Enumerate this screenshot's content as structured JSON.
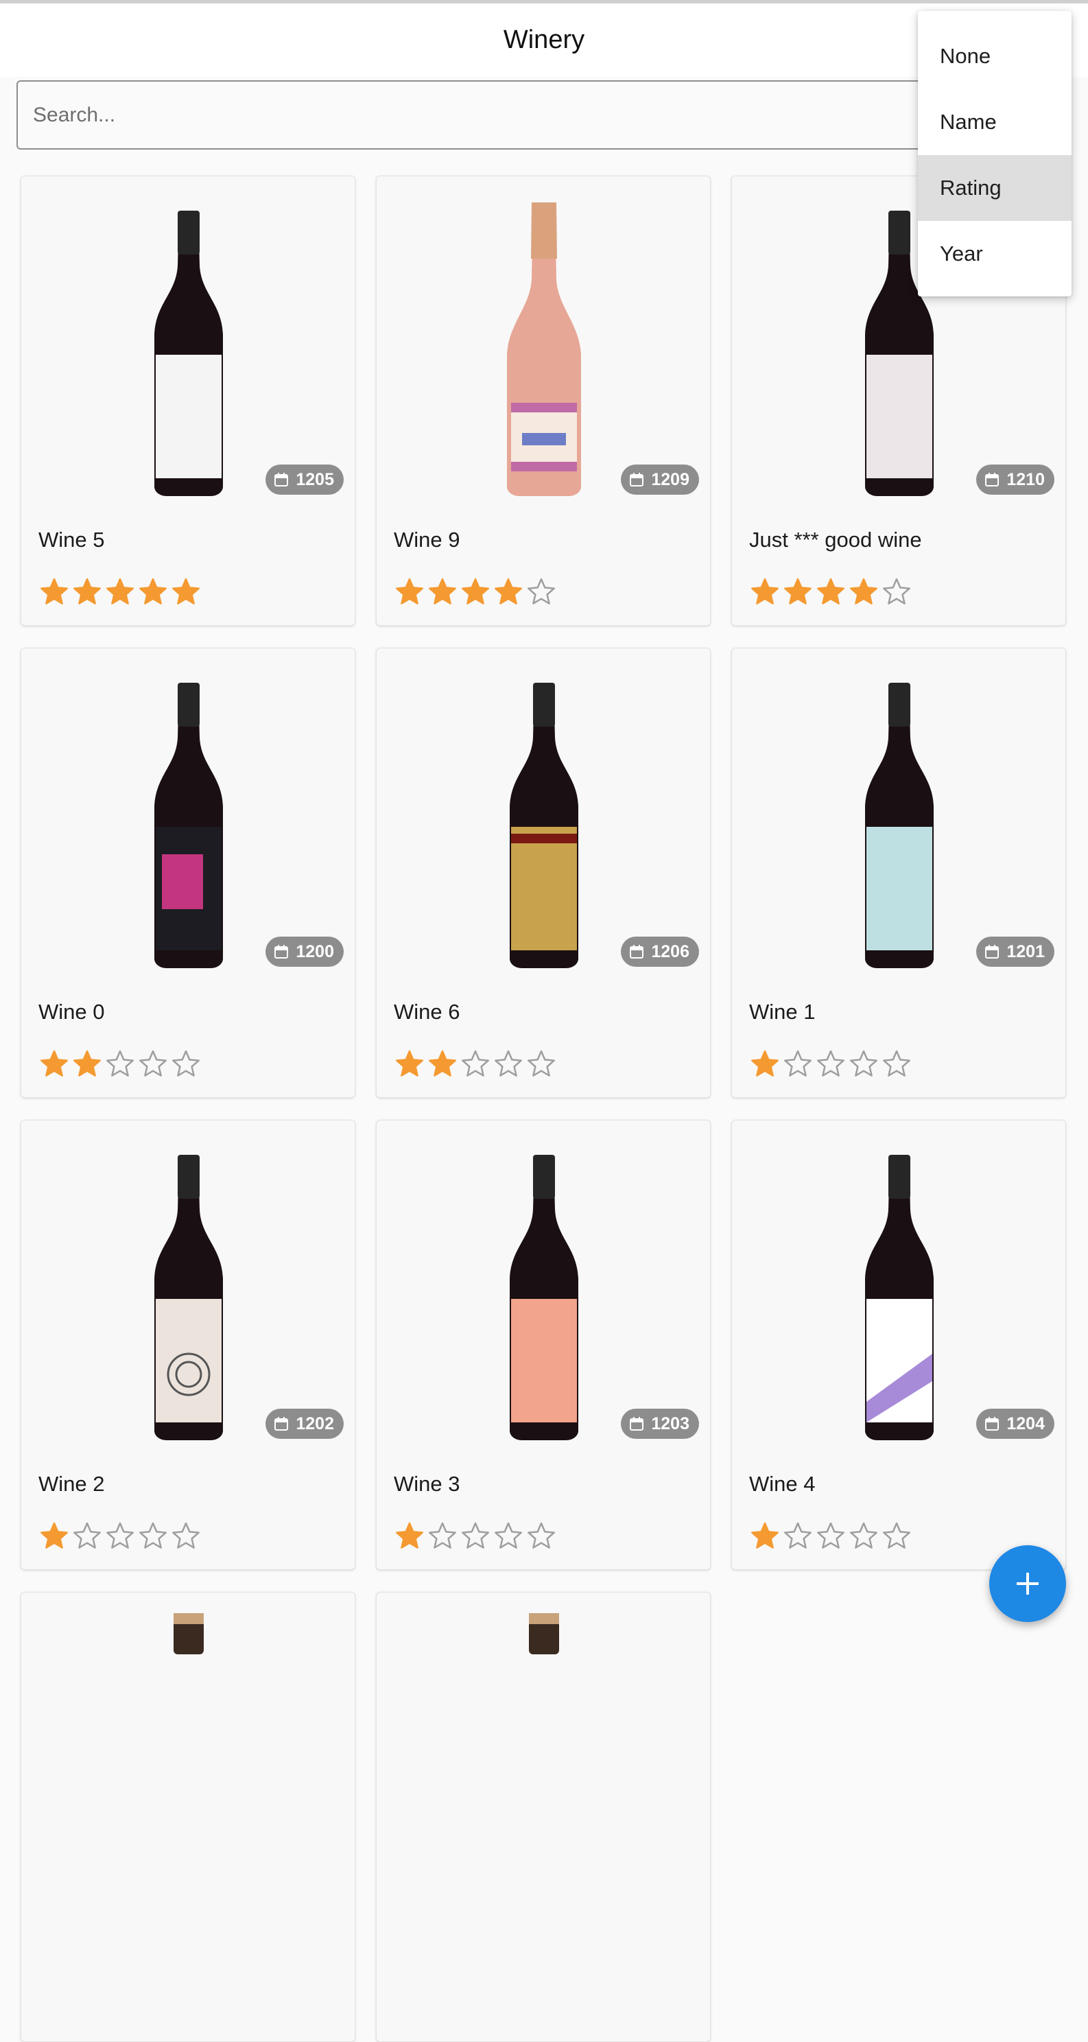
{
  "app": {
    "title": "Winery"
  },
  "search": {
    "placeholder": "Search..."
  },
  "sort_menu": {
    "items": [
      {
        "label": "None",
        "selected": false
      },
      {
        "label": "Name",
        "selected": false
      },
      {
        "label": "Rating",
        "selected": true
      },
      {
        "label": "Year",
        "selected": false
      }
    ]
  },
  "wines": [
    {
      "name": "Wine 5",
      "year": "1205",
      "rating": 5,
      "bottle": "red-white-label",
      "label_color": "#f4f4f4"
    },
    {
      "name": "Wine 9",
      "year": "1209",
      "rating": 4,
      "bottle": "rose-sparkling",
      "label_color": "#f6e9df"
    },
    {
      "name": "Just *** good wine",
      "year": "1210",
      "rating": 4,
      "bottle": "red-white-label",
      "label_color": "#ece6e9"
    },
    {
      "name": "Wine 0",
      "year": "1200",
      "rating": 2,
      "bottle": "red-dark-label",
      "label_color": "#1c1c22"
    },
    {
      "name": "Wine 6",
      "year": "1206",
      "rating": 2,
      "bottle": "red-gold-label",
      "label_color": "#c9a24c"
    },
    {
      "name": "Wine 1",
      "year": "1201",
      "rating": 1,
      "bottle": "red-blue-label",
      "label_color": "#bfe0e3"
    },
    {
      "name": "Wine 2",
      "year": "1202",
      "rating": 1,
      "bottle": "red-cream-label",
      "label_color": "#ece3dc"
    },
    {
      "name": "Wine 3",
      "year": "1203",
      "rating": 1,
      "bottle": "red-peach-label",
      "label_color": "#f2a58c"
    },
    {
      "name": "Wine 4",
      "year": "1204",
      "rating": 1,
      "bottle": "red-purple-label",
      "label_color": "#ffffff"
    },
    {
      "name": "",
      "year": "",
      "rating": 0,
      "bottle": "partial",
      "label_color": "#ffffff"
    },
    {
      "name": "",
      "year": "",
      "rating": 0,
      "bottle": "partial",
      "label_color": "#ffffff"
    }
  ],
  "fab": {
    "icon": "plus-icon",
    "color": "#1e88e5"
  },
  "colors": {
    "star_filled": "#f49a31",
    "star_empty": "#9e9e9e",
    "badge": "#8d8d8d"
  }
}
